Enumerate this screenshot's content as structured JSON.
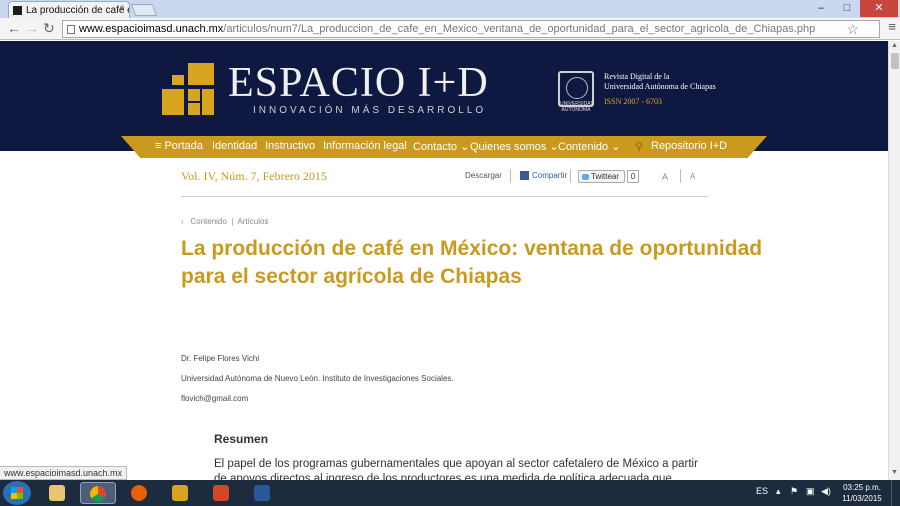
{
  "browser": {
    "tab_title": "La producción de café en",
    "tab_close": "×",
    "window_controls": [
      "–",
      "□",
      "✕"
    ],
    "url_host": "www.espacioimasd.unach.mx",
    "url_path": "/articulos/num7/La_produccion_de_cafe_en_Mexico_ventana_de_oportunidad_para_el_sector_agricola_de_Chiapas.php",
    "status_text": "www.espacioimasd.unach.mx"
  },
  "header": {
    "logo_title": "ESPACIO I+D",
    "logo_subtitle": "INNOVACIÓN MÁS DESARROLLO",
    "seal_label": "UNIVERSIDAD AUTÓNOMA",
    "journal_line1": "Revista Digital de la",
    "journal_line2": "Universidad Autónoma de Chiapas",
    "issn": "ISSN 2007 - 6703"
  },
  "nav": {
    "items": [
      "≡ Portada",
      "Identidad",
      "Instructivo",
      "Información legal",
      "Contacto ⌄",
      "Quienes somos ⌄",
      "Contenido ⌄",
      "Repositorio I+D"
    ],
    "search_icon": "search-icon"
  },
  "article": {
    "volume": "Vol. IV, Núm. 7, Febrero 2015",
    "download": "Descargar",
    "share": "Compartir",
    "tweet": "Twittear",
    "tweet_count": "0",
    "font_up": "A",
    "font_down": "A",
    "breadcrumb_1": "Contenido",
    "breadcrumb_2": "Artículos",
    "title": "La producción de café en México: ventana de oportunidad para el sector agrícola de Chiapas",
    "author": "Dr. Felipe Flores Vichi",
    "affiliation": "Universidad Autónoma de Nuevo León. Instituto de Investigaciones Sociales.",
    "email": "flovich@gmail.com",
    "abstract_heading": "Resumen",
    "abstract_text": "El papel de los programas gubernamentales que apoyan al sector cafetalero de México a partir de apoyos directos al ingreso de los productores es una medida de política adecuada que permite cubrir el diferencial entre los costos e ingresos totales de la actividad agrícola. El estado de Chiapas ...ones necesarias para enfrentar y competir en un mercado internacional, sin"
  },
  "taskbar": {
    "language": "ES",
    "time": "03:25 p.m.",
    "date": "11/03/2015"
  }
}
